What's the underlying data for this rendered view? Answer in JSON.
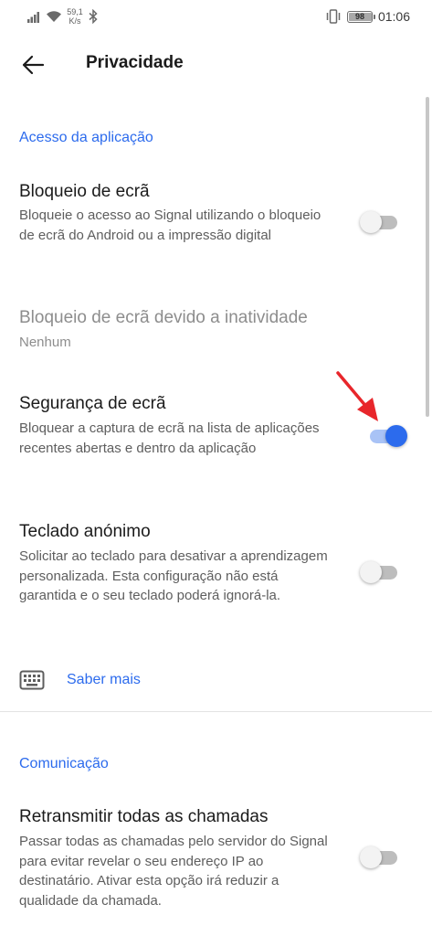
{
  "status_bar": {
    "net_speed_value": "59,1",
    "net_speed_unit": "K/s",
    "battery": "98",
    "battery_level": 0.98,
    "time": "01:06",
    "icons": [
      "signal-icon",
      "wifi-icon",
      "bluetooth-icon",
      "vibrate-icon",
      "battery-icon"
    ]
  },
  "app_bar": {
    "title": "Privacidade",
    "back_icon": "arrow-left-icon"
  },
  "sections": {
    "app_access": {
      "header": "Acesso da aplicação",
      "screen_lock": {
        "title": "Bloqueio de ecrã",
        "summary": "Bloqueie o acesso ao Signal utilizando o bloqueio de ecrã do Android ou a impressão digital",
        "enabled": false
      },
      "inactivity_lock": {
        "title": "Bloqueio de ecrã devido a inatividade",
        "summary": "Nenhum"
      },
      "screen_security": {
        "title": "Segurança de ecrã",
        "summary": "Bloquear a captura de ecrã na lista de aplicações recentes abertas e dentro da aplicação",
        "enabled": true
      },
      "incognito_keyboard": {
        "title": "Teclado anónimo",
        "summary": "Solicitar ao teclado para desativar a aprendizagem personalizada. Esta configuração não está garantida e o seu teclado poderá ignorá-la.",
        "enabled": false
      },
      "learn_more": {
        "label": "Saber mais",
        "icon": "keyboard-icon"
      }
    },
    "communication": {
      "header": "Comunicação",
      "relay_calls": {
        "title": "Retransmitir todas as chamadas",
        "summary": "Passar todas as chamadas pelo servidor do Signal para evitar revelar o seu endereço IP ao destinatário. Ativar esta opção irá reduzir a qualidade da chamada.",
        "enabled": false
      }
    }
  },
  "colors": {
    "accent": "#2c6bed",
    "annotation_arrow": "#e8262b"
  }
}
